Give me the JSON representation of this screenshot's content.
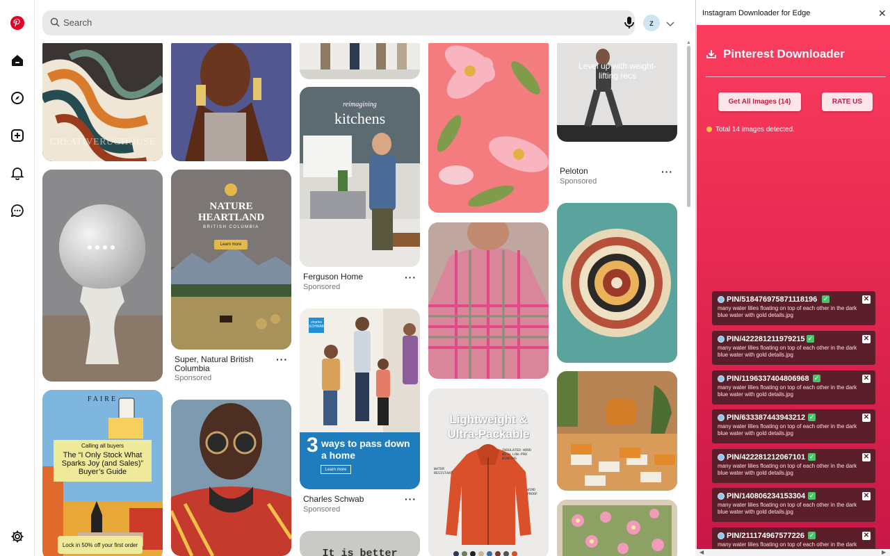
{
  "search": {
    "placeholder": "Search"
  },
  "account": {
    "initial": "z"
  },
  "rail": {
    "brand_color": "#e60023"
  },
  "pins": {
    "p1": {
      "overlay": "CREATIVERUGHOUSE"
    },
    "p2": {
      "title": "Super, Natural British Columbia",
      "sub": "Sponsored",
      "overlay_big": "NATURE\nHEARTLAND",
      "overlay_small": "BRITISH COLUMBIA",
      "overlay_btn": "Learn more"
    },
    "p3": {
      "title": "Ferguson Home",
      "sub": "Sponsored",
      "overlay_script": "reimagining",
      "overlay_big": "kitchens"
    },
    "p4": {
      "title": "Charles Schwab",
      "sub": "Sponsored",
      "overlay_num": "3",
      "overlay_text": "ways to pass down a home",
      "overlay_btn": "Learn more",
      "logo": "charles SCHWAB"
    },
    "p5": {
      "overlay_big": "Lightweight & Ultra-Packable",
      "tag1": "INSULATED HOOD WITH LOW-PRO BINDING",
      "tag2": "WATER RESISTANT",
      "tag3": "WIND PROOF"
    },
    "p6": {
      "title": "Peloton",
      "sub": "Sponsored",
      "overlay": "Level up with weight-lifting recs"
    },
    "p7": {
      "brand": "FAIRE",
      "kicker": "Calling all buyers",
      "headline": "The “I Only Stock What Sparks Joy (and Sales)” Buyer’s Guide",
      "cta": "Lock in 50% off your first order"
    },
    "p8": {
      "overlay": "It is better"
    }
  },
  "extension": {
    "window_title": "Instagram Downloader for Edge",
    "heading": "Pinterest Downloader",
    "get_all_label": "Get All Images (14)",
    "rate_label": "RATE US",
    "status": "Total 14 images detected.",
    "items": [
      {
        "id": "PIN/518476975871118196",
        "desc": "many water lilies floating on top of each other in the dark blue water with gold details.jpg"
      },
      {
        "id": "PIN/422281211979215",
        "desc": "many water lilies floating on top of each other in the dark blue water with gold details.jpg"
      },
      {
        "id": "PIN/1196337404806968",
        "desc": "many water lilies floating on top of each other in the dark blue water with gold details.jpg"
      },
      {
        "id": "PIN/633387443943212",
        "desc": "many water lilies floating on top of each other in the dark blue water with gold details.jpg"
      },
      {
        "id": "PIN/422281212067101",
        "desc": "many water lilies floating on top of each other in the dark blue water with gold details.jpg"
      },
      {
        "id": "PIN/140806234153304",
        "desc": "many water lilies floating on top of each other in the dark blue water with gold details.jpg"
      },
      {
        "id": "PIN/211174967577226",
        "desc": "many water lilies floating on top of each other in the dark blue water with gold details.jpg"
      }
    ]
  },
  "colors": {
    "brand": "#e60023",
    "ext_accent": "#e82b52",
    "card_bg": "#5a1f2a"
  },
  "icons": [
    "pinterest-logo-icon",
    "home-icon",
    "explore-icon",
    "create-icon",
    "notifications-icon",
    "messages-icon",
    "settings-icon",
    "search-icon",
    "microphone-icon",
    "chevron-down-icon",
    "close-icon",
    "download-icon",
    "check-icon",
    "remove-icon"
  ]
}
